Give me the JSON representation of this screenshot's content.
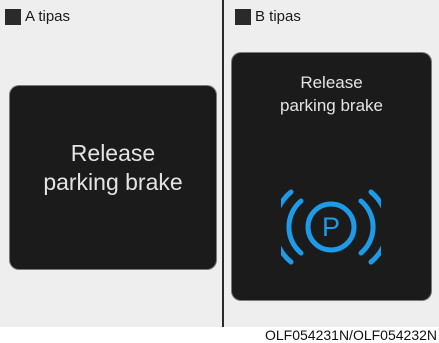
{
  "panel_a": {
    "header": "A tipas",
    "message_line1": "Release",
    "message_line2": "parking brake"
  },
  "panel_b": {
    "header": "B tipas",
    "message_line1": "Release",
    "message_line2": "parking brake",
    "icon": "parking-brake-icon",
    "icon_letter": "P",
    "icon_color": "#1e9be8"
  },
  "caption": "OLF054231N/OLF054232N",
  "colors": {
    "screen_bg": "#1b1b1b",
    "screen_text": "#e4e4e4",
    "panel_bg": "#eeeeee"
  }
}
